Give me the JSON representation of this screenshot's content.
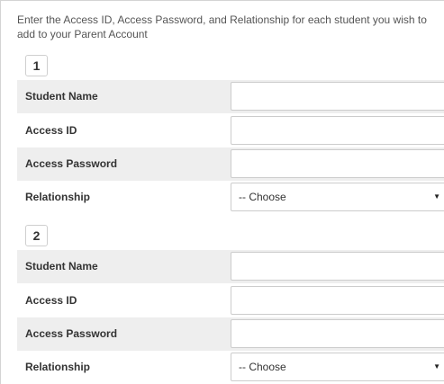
{
  "intro_text": "Enter the Access ID, Access Password, and Relationship for each student you wish to add to your Parent Account",
  "students": [
    {
      "number": "1",
      "fields": {
        "student_name_label": "Student Name",
        "student_name_value": "",
        "access_id_label": "Access ID",
        "access_id_value": "",
        "access_password_label": "Access Password",
        "access_password_value": "",
        "relationship_label": "Relationship",
        "relationship_selected": "-- Choose"
      }
    },
    {
      "number": "2",
      "fields": {
        "student_name_label": "Student Name",
        "student_name_value": "",
        "access_id_label": "Access ID",
        "access_id_value": "",
        "access_password_label": "Access Password",
        "access_password_value": "",
        "relationship_label": "Relationship",
        "relationship_selected": "-- Choose"
      }
    }
  ],
  "icons": {
    "select_arrow": "caret-down-icon"
  },
  "colors": {
    "shaded_row": "#eeeeee",
    "border": "#cccccc",
    "text": "#333333"
  }
}
